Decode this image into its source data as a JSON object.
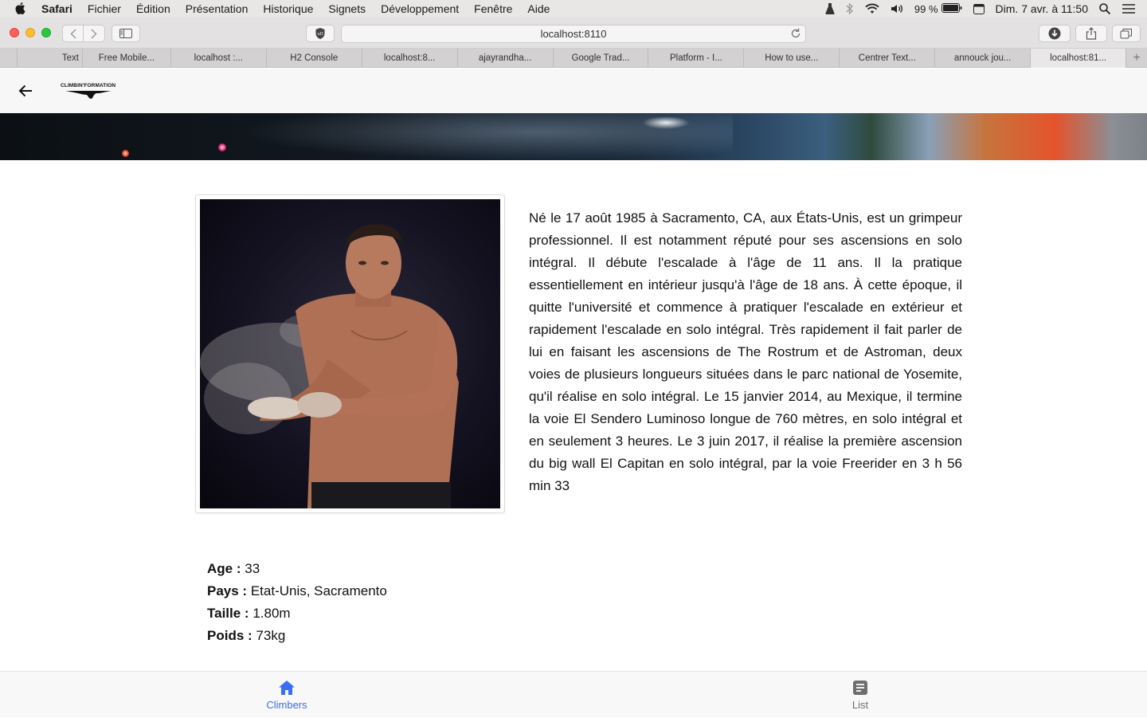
{
  "menubar": {
    "app_name": "Safari",
    "items": [
      "Fichier",
      "Édition",
      "Présentation",
      "Historique",
      "Signets",
      "Développement",
      "Fenêtre",
      "Aide"
    ],
    "battery": "99 %",
    "clock": "Dim. 7 avr. à 11:50"
  },
  "browser": {
    "url": "localhost:8110",
    "tabs": [
      {
        "label": "Text"
      },
      {
        "label": "Free Mobile..."
      },
      {
        "label": "localhost :..."
      },
      {
        "label": "H2 Console"
      },
      {
        "label": "localhost:8..."
      },
      {
        "label": "ajayrandha..."
      },
      {
        "label": "Google Trad..."
      },
      {
        "label": "Platform - I..."
      },
      {
        "label": "How to use..."
      },
      {
        "label": "Centrer Text..."
      },
      {
        "label": "annouck jou..."
      },
      {
        "label": "localhost:81..."
      }
    ],
    "active_tab_index": 11
  },
  "header": {
    "logo_text": "CLIMBIN'FORMATION"
  },
  "climber": {
    "bio": "Né le 17 août 1985 à Sacramento, CA, aux États-Unis, est un grimpeur professionnel. Il est notamment réputé pour ses ascensions en solo intégral. Il débute l'escalade à l'âge de 11 ans. Il la pratique essentiellement en intérieur jusqu'à l'âge de 18 ans. À cette époque, il quitte l'université et commence à pratiquer l'escalade en extérieur et rapidement l'escalade en solo intégral. Très rapidement il fait parler de lui en faisant les ascensions de The Rostrum et de Astroman, deux voies de plusieurs longueurs situées dans le parc national de Yosemite, qu'il réalise en solo intégral. Le 15 janvier 2014, au Mexique, il termine la voie El Sendero Luminoso longue de 760 mètres, en solo intégral et en seulement 3 heures. Le 3 juin 2017, il réalise la première ascension du big wall El Capitan en solo intégral, par la voie Freerider en 3 h 56 min 33",
    "facts": {
      "age_label": "Age :",
      "age_value": "33",
      "country_label": "Pays :",
      "country_value": "Etat-Unis, Sacramento",
      "height_label": "Taille :",
      "height_value": "1.80m",
      "weight_label": "Poids :",
      "weight_value": "73kg"
    }
  },
  "bottom_nav": {
    "climbers_label": "Climbers",
    "list_label": "List",
    "active": "climbers"
  },
  "colors": {
    "accent": "#3b6ef5",
    "inactive": "#6e6e6e"
  }
}
